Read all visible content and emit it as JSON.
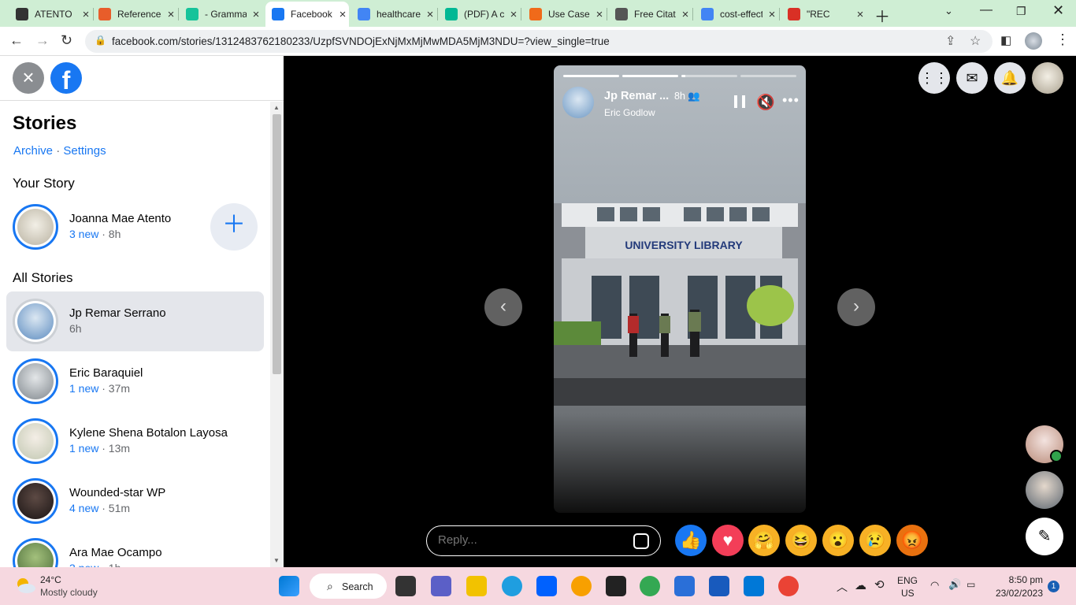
{
  "browser": {
    "tabs": [
      {
        "title": "ATENTO",
        "icon": "github-icon",
        "color": "#333333"
      },
      {
        "title": "References",
        "icon": "stack-icon",
        "color": "#e85d2a"
      },
      {
        "title": "- Grammarly",
        "icon": "grammarly-icon",
        "color": "#15c39a"
      },
      {
        "title": "Facebook",
        "icon": "facebook-icon",
        "color": "#1877f2"
      },
      {
        "title": "healthcare",
        "icon": "google-icon",
        "color": "#4285f4"
      },
      {
        "title": "(PDF) A c",
        "icon": "researchgate-icon",
        "color": "#00b894"
      },
      {
        "title": "Use Cases",
        "icon": "ubuntu-icon",
        "color": "#f06a1a"
      },
      {
        "title": "Free Citation",
        "icon": "pen-icon",
        "color": "#555555"
      },
      {
        "title": "cost-effective",
        "icon": "google-icon",
        "color": "#4285f4"
      },
      {
        "title": "\"REC",
        "icon": "gmail-icon",
        "color": "#d93025"
      }
    ],
    "url": "facebook.com/stories/1312483762180233/UzpfSVNDOjExNjMxMjMwMDA5MjM3NDU=?view_single=true"
  },
  "sidebar": {
    "title": "Stories",
    "archive": "Archive",
    "separator": "·",
    "settings": "Settings",
    "your_story_heading": "Your Story",
    "your_story": {
      "name": "Joanna Mae Atento",
      "new": "3 new",
      "time": " · 8h"
    },
    "all_stories_heading": "All Stories",
    "stories": [
      {
        "name": "Jp Remar Serrano",
        "new": "",
        "time": "6h",
        "selected": true
      },
      {
        "name": "Eric Baraquiel",
        "new": "1 new",
        "time": " · 37m",
        "selected": false
      },
      {
        "name": "Kylene Shena Botalon Layosa",
        "new": "1 new",
        "time": " · 13m",
        "selected": false
      },
      {
        "name": "Wounded-star WP",
        "new": "4 new",
        "time": " · 51m",
        "selected": false
      },
      {
        "name": "Ara Mae Ocampo",
        "new": "3 new",
        "time": " · 1h",
        "selected": false
      }
    ]
  },
  "viewer": {
    "author": "Jp Remar ...",
    "time": "8h",
    "subtitle": "Eric Godlow",
    "photo_sign": "UNIVERSITY LIBRARY",
    "progress": [
      1,
      1,
      0.07,
      0
    ],
    "reply_placeholder": "Reply...",
    "reactions": [
      {
        "name": "like",
        "glyph": "👍",
        "color": "#1877f2"
      },
      {
        "name": "love",
        "glyph": "♥",
        "color": "#f33e58"
      },
      {
        "name": "care",
        "glyph": "🤗",
        "color": "#f7b125"
      },
      {
        "name": "haha",
        "glyph": "😆",
        "color": "#f7b125"
      },
      {
        "name": "wow",
        "glyph": "😮",
        "color": "#f7b125"
      },
      {
        "name": "sad",
        "glyph": "😢",
        "color": "#f7b125"
      },
      {
        "name": "angry",
        "glyph": "😡",
        "color": "#e9710f"
      }
    ]
  },
  "taskbar": {
    "temp": "24°C",
    "weather": "Mostly cloudy",
    "search": "Search",
    "lang1": "ENG",
    "lang2": "US",
    "time": "8:50 pm",
    "date": "23/02/2023",
    "notifications": "1"
  }
}
